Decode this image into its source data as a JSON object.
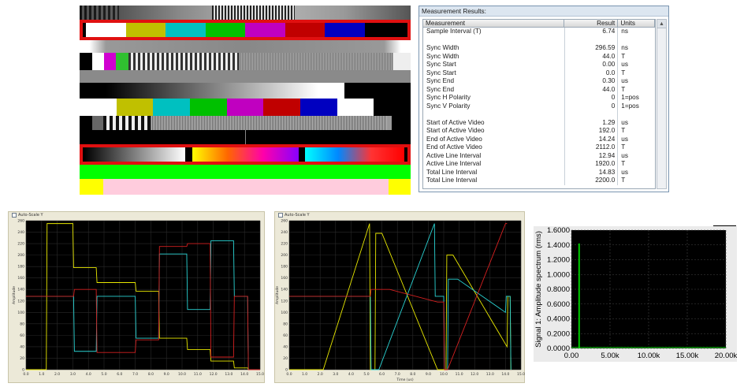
{
  "measurement_panel": {
    "title": "Measurement Results:",
    "columns": [
      "Measurement",
      "Result",
      "Units"
    ],
    "rows": [
      {
        "m": "Sample Interval (T)",
        "r": "6.74",
        "u": "ns"
      },
      {
        "m": "",
        "r": "",
        "u": ""
      },
      {
        "m": "Sync Width",
        "r": "296.59",
        "u": "ns"
      },
      {
        "m": "Sync Width",
        "r": "44.0",
        "u": "T"
      },
      {
        "m": "Sync Start",
        "r": "0.00",
        "u": "us"
      },
      {
        "m": "Sync Start",
        "r": "0.0",
        "u": "T"
      },
      {
        "m": "Sync End",
        "r": "0.30",
        "u": "us"
      },
      {
        "m": "Sync End",
        "r": "44.0",
        "u": "T"
      },
      {
        "m": "Sync H Polarity",
        "r": "0",
        "u": "1=pos"
      },
      {
        "m": "Sync V Polarity",
        "r": "0",
        "u": "1=pos"
      },
      {
        "m": "",
        "r": "",
        "u": ""
      },
      {
        "m": "Start of Active Video",
        "r": "1.29",
        "u": "us"
      },
      {
        "m": "Start of Active Video",
        "r": "192.0",
        "u": "T"
      },
      {
        "m": "End of Active Video",
        "r": "14.24",
        "u": "us"
      },
      {
        "m": "End of Active Video",
        "r": "2112.0",
        "u": "T"
      },
      {
        "m": "Active Line Interval",
        "r": "12.94",
        "u": "us"
      },
      {
        "m": "Active Line Interval",
        "r": "1920.0",
        "u": "T"
      },
      {
        "m": "Total Line Interval",
        "r": "14.83",
        "u": "us"
      },
      {
        "m": "Total Line Interval",
        "r": "2200.0",
        "u": "T"
      }
    ]
  },
  "colors": {
    "colorbar_1": [
      "#ffffff",
      "#c0c000",
      "#00c0c0",
      "#00c000",
      "#c000c0",
      "#c00000",
      "#0000c0",
      "#000000"
    ],
    "colorbar_2": [
      "#ffffff",
      "#c0c000",
      "#00c0c0",
      "#00c000",
      "#c000c0",
      "#c00000",
      "#0000c0",
      "#ffffff",
      "#000000"
    ],
    "highlight_frame": "#e01010",
    "green_band": "#00ff00",
    "pink_band": "#ffccdd",
    "yellow_band": "#ffff00",
    "scope_trace_yellow": "#e8e800",
    "scope_trace_cyan": "#2ad4d4",
    "scope_trace_red": "#d42020",
    "spectrum_trace": "#00cc00"
  },
  "scope_left": {
    "checkbox_label": "Auto-Scale Y",
    "y_axis_label": "Amplitude",
    "x_axis_label": "",
    "y_ticks": [
      "0",
      "20",
      "40",
      "60",
      "80",
      "100",
      "120",
      "140",
      "160",
      "180",
      "200",
      "220",
      "240",
      "260"
    ],
    "x_ticks": [
      "0.0",
      "1.0",
      "2.0",
      "3.0",
      "4.0",
      "5.0",
      "6.0",
      "7.0",
      "8.0",
      "9.0",
      "10.0",
      "11.0",
      "12.0",
      "13.0",
      "14.0",
      "15.0"
    ]
  },
  "scope_mid": {
    "checkbox_label": "Auto-Scale Y",
    "y_axis_label": "Amplitude",
    "x_axis_label": "Time (us)",
    "y_ticks": [
      "0",
      "20",
      "40",
      "60",
      "80",
      "100",
      "120",
      "140",
      "160",
      "180",
      "200",
      "220",
      "240",
      "260"
    ],
    "x_ticks": [
      "0.0",
      "1.0",
      "2.0",
      "3.0",
      "4.0",
      "5.0",
      "6.0",
      "7.0",
      "8.0",
      "9.0",
      "10.0",
      "11.0",
      "12.0",
      "13.0",
      "14.0",
      "15.0"
    ]
  },
  "spectrum": {
    "y_axis_label": "Signal 1: Amplitude spectrum (rms)",
    "y_ticks": [
      "0.0000",
      "0.2000",
      "0.4000",
      "0.6000",
      "0.8000",
      "1.0000",
      "1.2000",
      "1.4000",
      "1.6000"
    ],
    "x_ticks": [
      "0.00",
      "5.00k",
      "10.00k",
      "15.00k",
      "20.00k"
    ],
    "peak_value": 1.42
  }
}
